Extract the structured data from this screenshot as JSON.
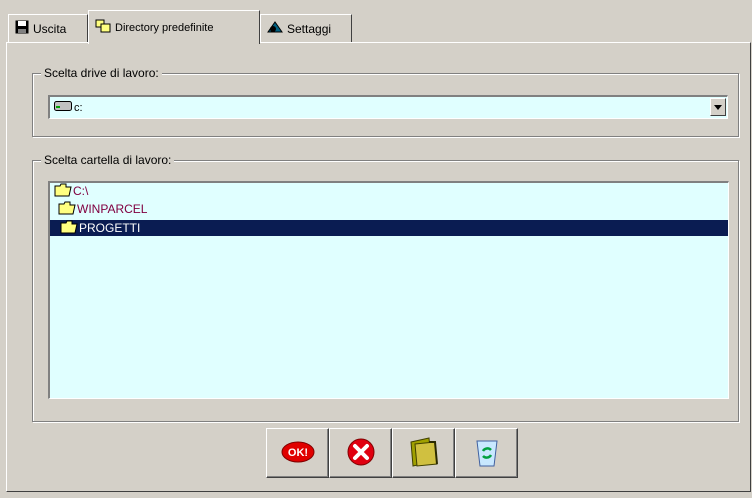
{
  "tabs": [
    {
      "label": "Uscita",
      "icon": "floppy-disk-icon",
      "active": false
    },
    {
      "label": "Directory predefinite",
      "icon": "folders-icon",
      "active": true
    },
    {
      "label": "Settaggi",
      "icon": "settings-icon",
      "active": false
    }
  ],
  "drive_group": {
    "title": "Scelta drive di lavoro:",
    "selected_drive": "c:",
    "drive_icon": "hard-drive-icon"
  },
  "folder_group": {
    "title": "Scelta cartella di lavoro:",
    "folders": [
      {
        "label": "C:\\",
        "icon": "open-folder-icon",
        "selected": false
      },
      {
        "label": "WINPARCEL",
        "icon": "open-folder-icon",
        "selected": false
      },
      {
        "label": "PROGETTI",
        "icon": "open-folder-icon",
        "selected": true
      }
    ]
  },
  "toolbar": {
    "ok_label": "OK!",
    "buttons": [
      "ok-icon",
      "cancel-icon",
      "folder-icon",
      "recycle-bin-icon"
    ]
  },
  "colors": {
    "window_bg": "#d4d0c8",
    "field_bg": "#e0ffff",
    "selection_bg": "#0a1c52",
    "folder_text": "#800040"
  }
}
